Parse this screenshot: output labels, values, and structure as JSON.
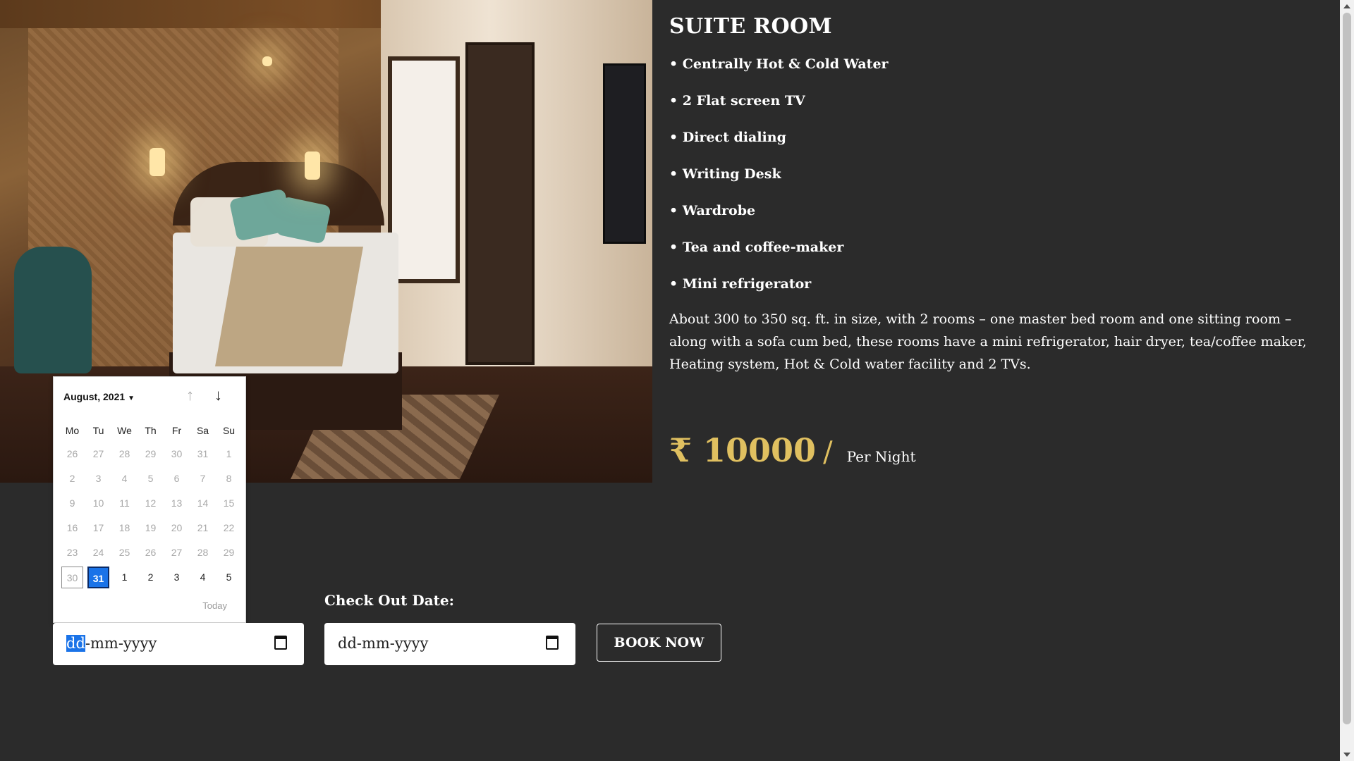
{
  "room": {
    "title": "SUITE ROOM",
    "features": [
      "• Centrally Hot & Cold Water",
      "• 2 Flat screen TV",
      "• Direct dialing",
      "• Writing Desk",
      "• Wardrobe",
      "• Tea and coffee-maker",
      "• Mini refrigerator"
    ],
    "description": "About 300 to 350 sq. ft. in size, with 2 rooms – one master bed room and one sitting room – along with a sofa cum bed, these rooms have a mini refrigerator, hair dryer, tea/coffee maker, Heating system, Hot & Cold water facility and 2 TVs.",
    "price": "₹ 10000",
    "price_separator": "/",
    "price_unit": "Per Night"
  },
  "datepicker": {
    "month_label": "August, 2021",
    "weekdays": [
      "Mo",
      "Tu",
      "We",
      "Th",
      "Fr",
      "Sa",
      "Su"
    ],
    "weeks": [
      [
        "26",
        "27",
        "28",
        "29",
        "30",
        "31",
        "1"
      ],
      [
        "2",
        "3",
        "4",
        "5",
        "6",
        "7",
        "8"
      ],
      [
        "9",
        "10",
        "11",
        "12",
        "13",
        "14",
        "15"
      ],
      [
        "16",
        "17",
        "18",
        "19",
        "20",
        "21",
        "22"
      ],
      [
        "23",
        "24",
        "25",
        "26",
        "27",
        "28",
        "29"
      ],
      [
        "30",
        "31",
        "1",
        "2",
        "3",
        "4",
        "5"
      ]
    ],
    "selected_day": "31",
    "today_label": "Today",
    "nav_up": "↑",
    "nav_down": "↓"
  },
  "booking": {
    "checkout_label": "Check  Out  Date:",
    "checkin_placeholder_dd": "dd",
    "checkin_placeholder_rest": "-mm-yyyy",
    "checkout_placeholder": "dd-mm-yyyy",
    "book_button": "BOOK NOW"
  },
  "colors": {
    "background": "#2b2b2b",
    "accent_gold": "#e0c060",
    "selected_blue": "#1a73e8"
  }
}
